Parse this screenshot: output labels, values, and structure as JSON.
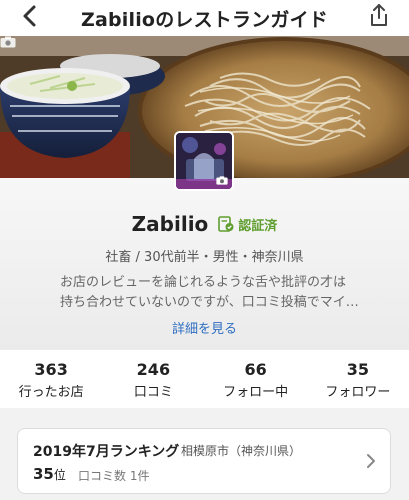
{
  "nav": {
    "title": "Zabilioのレストランガイド",
    "back_icon": "chevron-left-icon",
    "share_icon": "share-icon"
  },
  "profile": {
    "username": "Zabilio",
    "verified_label": "認証済",
    "meta": "社畜 / 30代前半・男性・神奈川県",
    "bio_line1": "お店のレビューを論じれるような舌や批評の才は",
    "bio_line2": "持ち合わせていないのですが、口コミ投稿でマイ…",
    "more_link": "詳細を見る"
  },
  "stats": [
    {
      "value": "363",
      "label": "行ったお店"
    },
    {
      "value": "246",
      "label": "口コミ"
    },
    {
      "value": "66",
      "label": "フォロー中"
    },
    {
      "value": "35",
      "label": "フォロワー"
    }
  ],
  "ranking": {
    "title": "2019年7月ランキング",
    "area": "相模原市（神奈川県）",
    "rank_number": "35",
    "rank_suffix": "位",
    "review_count": "口コミ数 1件"
  },
  "colors": {
    "accent_link": "#2f6ec0",
    "verified_green": "#5f9e2f"
  }
}
